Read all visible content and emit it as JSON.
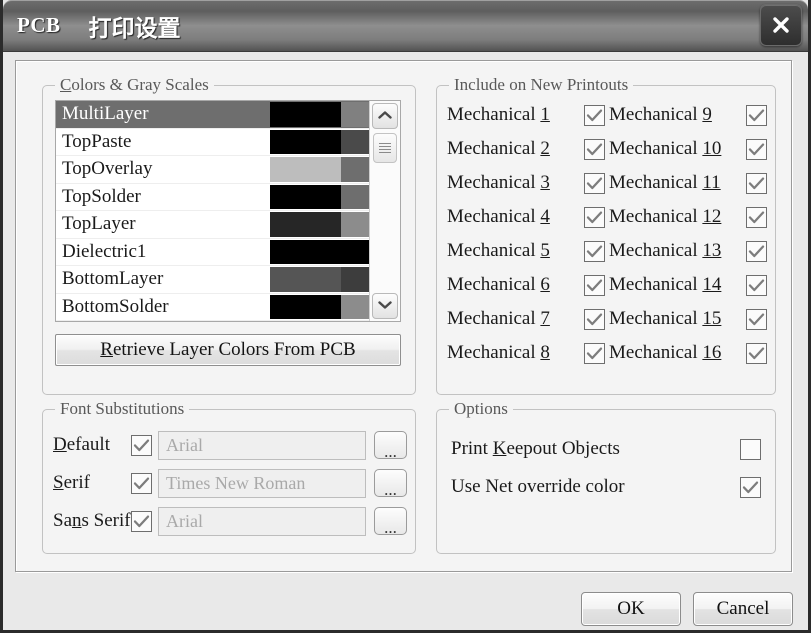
{
  "window": {
    "app_name": "PCB",
    "title": "打印设置",
    "close_icon": "close-icon"
  },
  "colors_group": {
    "title": "Colors & Gray Scales",
    "title_accel": "C",
    "layers": [
      {
        "name": "MultiLayer",
        "selected": true,
        "color_a": "#000000",
        "color_b": "#808080",
        "full_width": false
      },
      {
        "name": "TopPaste",
        "selected": false,
        "color_a": "#000000",
        "color_b": "#4a4a4a",
        "full_width": false
      },
      {
        "name": "TopOverlay",
        "selected": false,
        "color_a": "#bdbdbd",
        "color_b": "#6e6e6e",
        "full_width": false
      },
      {
        "name": "TopSolder",
        "selected": false,
        "color_a": "#000000",
        "color_b": "#6e6e6e",
        "full_width": false
      },
      {
        "name": "TopLayer",
        "selected": false,
        "color_a": "#262626",
        "color_b": "#8c8c8c",
        "full_width": false
      },
      {
        "name": "Dielectric1",
        "selected": false,
        "color_a": "#000000",
        "color_b": "#000000",
        "full_width": true
      },
      {
        "name": "BottomLayer",
        "selected": false,
        "color_a": "#555555",
        "color_b": "#3d3d3d",
        "full_width": false
      },
      {
        "name": "BottomSolder",
        "selected": false,
        "color_a": "#000000",
        "color_b": "#8c8c8c",
        "full_width": false
      }
    ],
    "scrollbar": {
      "up_icon": "chevron-up-icon",
      "down_icon": "chevron-down-icon",
      "thumb_icon": "scroll-thumb-grip-icon"
    },
    "retrieve_button": "Retrieve Layer Colors From PCB",
    "retrieve_accel": "R"
  },
  "include_group": {
    "title": "Include on New Printouts",
    "column_left": [
      {
        "label": "Mechanical 1",
        "digit": "1",
        "checked": true
      },
      {
        "label": "Mechanical 2",
        "digit": "2",
        "checked": true
      },
      {
        "label": "Mechanical 3",
        "digit": "3",
        "checked": true
      },
      {
        "label": "Mechanical 4",
        "digit": "4",
        "checked": true
      },
      {
        "label": "Mechanical 5",
        "digit": "5",
        "checked": true
      },
      {
        "label": "Mechanical 6",
        "digit": "6",
        "checked": true
      },
      {
        "label": "Mechanical 7",
        "digit": "7",
        "checked": true
      },
      {
        "label": "Mechanical 8",
        "digit": "8",
        "checked": true
      }
    ],
    "column_right": [
      {
        "label": "Mechanical 9",
        "digit": "9",
        "checked": true
      },
      {
        "label": "Mechanical 10",
        "digit": "10",
        "checked": true
      },
      {
        "label": "Mechanical 11",
        "digit": "11",
        "checked": true
      },
      {
        "label": "Mechanical 12",
        "digit": "12",
        "checked": true
      },
      {
        "label": "Mechanical 13",
        "digit": "13",
        "checked": true
      },
      {
        "label": "Mechanical 14",
        "digit": "14",
        "checked": true
      },
      {
        "label": "Mechanical 15",
        "digit": "15",
        "checked": true
      },
      {
        "label": "Mechanical 16",
        "digit": "16",
        "checked": true
      }
    ]
  },
  "fonts_group": {
    "title": "Font Substitutions",
    "rows": [
      {
        "label": "Default",
        "accel": "D",
        "checked": true,
        "value": "Arial"
      },
      {
        "label": "Serif",
        "accel": "S",
        "checked": true,
        "value": "Times New Roman"
      },
      {
        "label": "Sans Serif",
        "accel": "n",
        "checked": true,
        "value": "Arial"
      }
    ],
    "browse_label": "..."
  },
  "options_group": {
    "title": "Options",
    "rows": [
      {
        "label": "Print Keepout Objects",
        "accel": "K",
        "checked": false
      },
      {
        "label": "Use Net override color",
        "accel": "",
        "checked": true
      }
    ]
  },
  "footer": {
    "ok_label": "OK",
    "cancel_label": "Cancel"
  }
}
